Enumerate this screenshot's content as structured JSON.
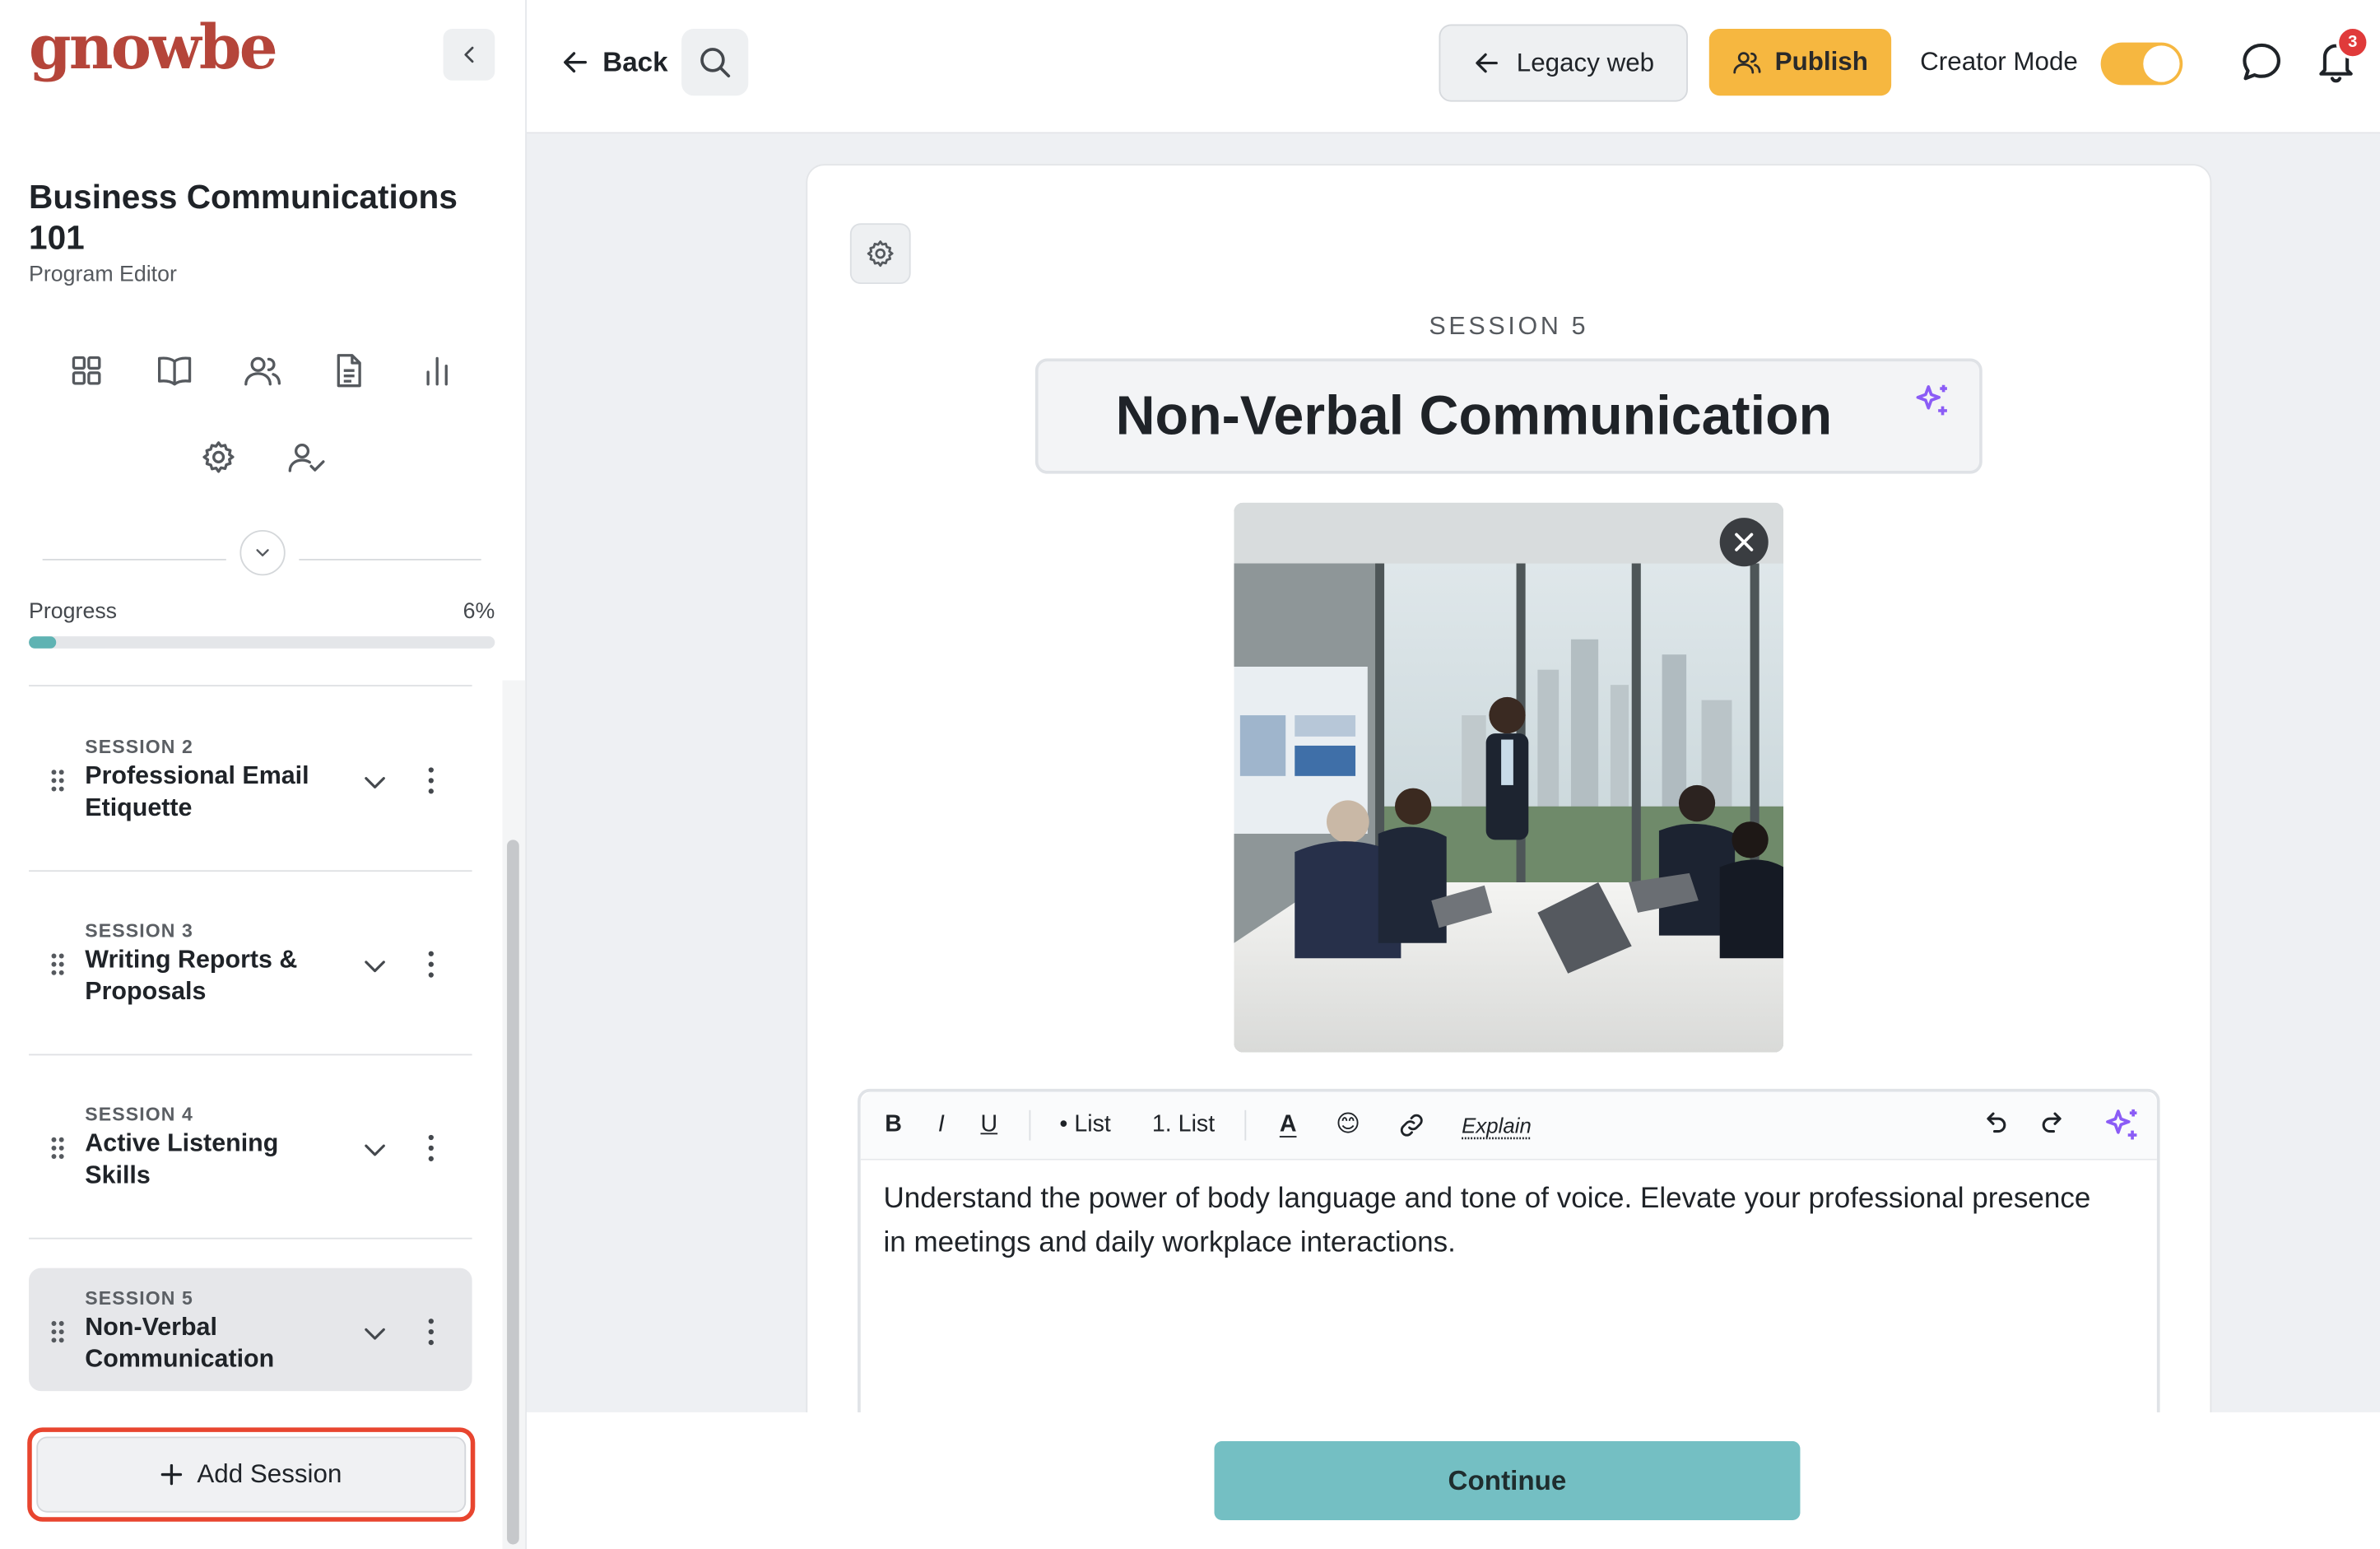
{
  "brand": {
    "logo_text": "gnowbe",
    "logo_color": "#b5453a"
  },
  "sidebar": {
    "program_title": "Business Communications 101",
    "program_subtitle": "Program Editor",
    "nav_icons": [
      "grid-icon",
      "book-icon",
      "users-icon",
      "document-icon",
      "chart-icon",
      "settings-icon",
      "user-check-icon"
    ],
    "progress": {
      "label": "Progress",
      "value_text": "6%",
      "value": 6
    },
    "sessions": [
      {
        "number": "SESSION 2",
        "title": "Professional Email Etiquette",
        "active": false
      },
      {
        "number": "SESSION 3",
        "title": "Writing Reports & Proposals",
        "active": false
      },
      {
        "number": "SESSION 4",
        "title": "Active Listening Skills",
        "active": false
      },
      {
        "number": "SESSION 5",
        "title": "Non-Verbal Communication",
        "active": true
      }
    ],
    "add_session_label": "Add Session"
  },
  "topbar": {
    "back_label": "Back",
    "legacy_label": "Legacy web",
    "publish_label": "Publish",
    "creator_mode_label": "Creator Mode",
    "creator_mode_on": true,
    "notification_count": "3"
  },
  "editor": {
    "session_label": "SESSION 5",
    "title": "Non-Verbal Communication",
    "toolbar": {
      "bold": "B",
      "italic": "I",
      "underline": "U",
      "bullet_list": "• List",
      "numbered_list": "1. List",
      "text_color": "A",
      "emoji": "😊",
      "explain": "Explain"
    },
    "body_text": "Understand the power of body language and tone of voice. Elevate your professional presence in meetings and daily workplace interactions."
  },
  "footer": {
    "continue_label": "Continue"
  },
  "colors": {
    "accent_yellow": "#f6b740",
    "teal": "#74bfc3",
    "progress_fill": "#5fb3b3",
    "purple": "#9b5de5",
    "highlight_red": "#e8452f",
    "badge_red": "#e03a3a"
  }
}
